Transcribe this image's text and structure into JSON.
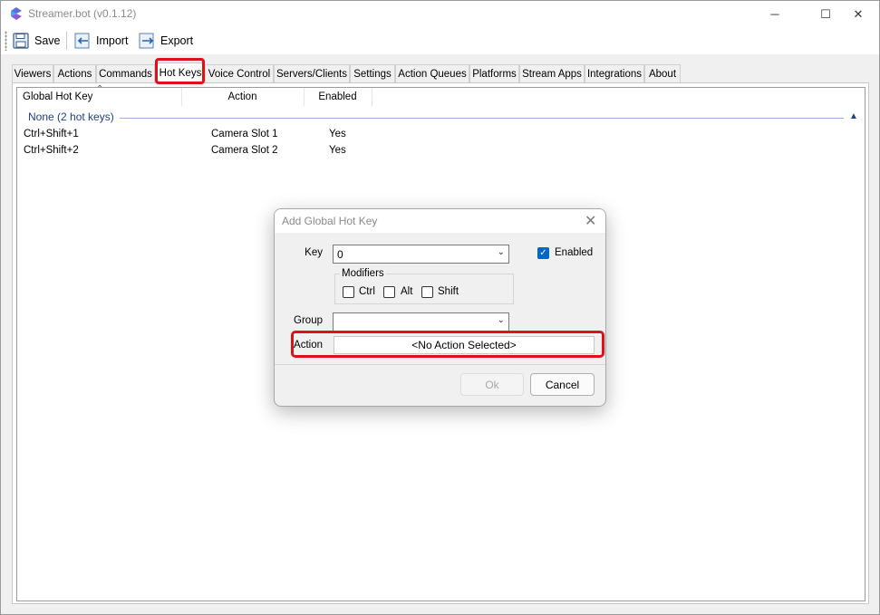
{
  "window": {
    "title": "Streamer.bot (v0.1.12)",
    "minimize_glyph": "─",
    "maximize_glyph": "☐",
    "close_glyph": "✕"
  },
  "toolbar": {
    "save_label": "Save",
    "import_label": "Import",
    "export_label": "Export"
  },
  "tabs": [
    {
      "label": "Viewers"
    },
    {
      "label": "Actions"
    },
    {
      "label": "Commands"
    },
    {
      "label": "Hot Keys",
      "active": true
    },
    {
      "label": "Voice Control"
    },
    {
      "label": "Servers/Clients"
    },
    {
      "label": "Settings"
    },
    {
      "label": "Action Queues"
    },
    {
      "label": "Platforms"
    },
    {
      "label": "Stream Apps"
    },
    {
      "label": "Integrations"
    },
    {
      "label": "About"
    }
  ],
  "hotkeys": {
    "columns": [
      "Global Hot Key",
      "Action",
      "Enabled"
    ],
    "group_label": "None (2 hot keys)",
    "rows": [
      {
        "hotkey": "Ctrl+Shift+1",
        "action": "Camera Slot 1",
        "enabled": "Yes"
      },
      {
        "hotkey": "Ctrl+Shift+2",
        "action": "Camera Slot 2",
        "enabled": "Yes"
      }
    ]
  },
  "dialog": {
    "title": "Add Global Hot Key",
    "key_label": "Key",
    "key_value": "0",
    "enabled_label": "Enabled",
    "enabled_checked": true,
    "modifiers_title": "Modifiers",
    "modifiers": [
      {
        "label": "Ctrl",
        "checked": false
      },
      {
        "label": "Alt",
        "checked": false
      },
      {
        "label": "Shift",
        "checked": false
      }
    ],
    "group_label": "Group",
    "group_value": "",
    "action_label": "Action",
    "action_value": "<No Action Selected>",
    "ok_label": "Ok",
    "cancel_label": "Cancel"
  },
  "colors": {
    "highlight": "#e0101a",
    "group_text": "#1e3f8a",
    "checkbox_accent": "#0067c0"
  }
}
